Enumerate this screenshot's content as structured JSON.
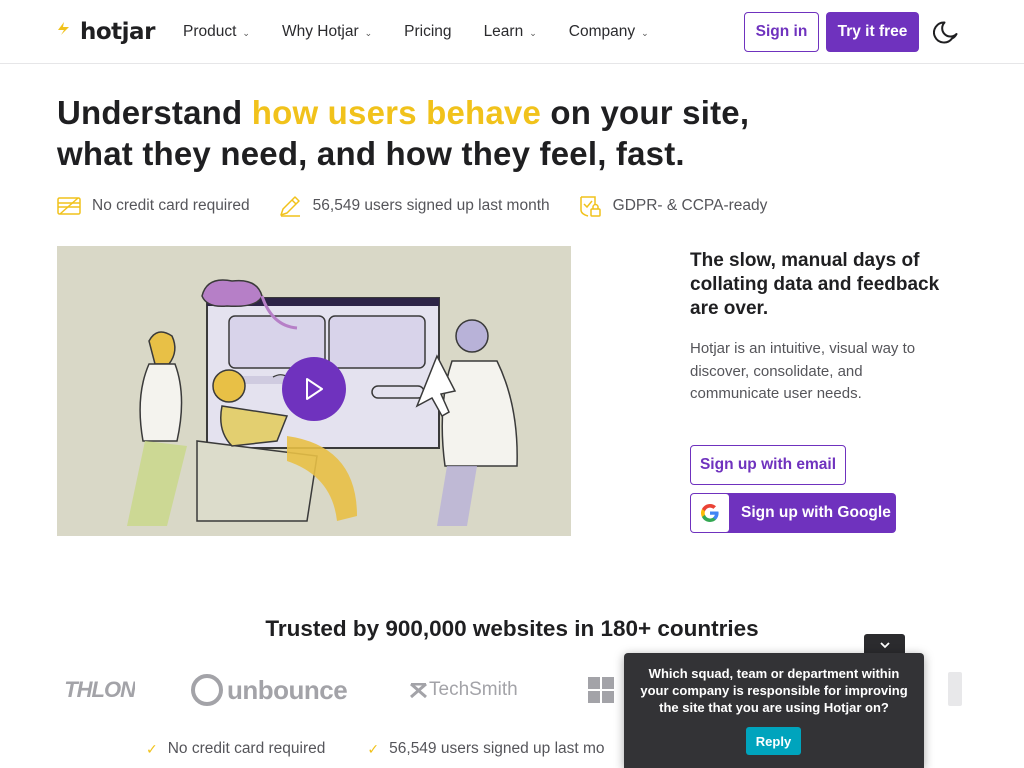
{
  "nav": {
    "logo_text": "hotjar",
    "items": [
      {
        "label": "Product",
        "dropdown": true
      },
      {
        "label": "Why Hotjar",
        "dropdown": true
      },
      {
        "label": "Pricing",
        "dropdown": false
      },
      {
        "label": "Learn",
        "dropdown": true
      },
      {
        "label": "Company",
        "dropdown": true
      }
    ],
    "sign_in": "Sign in",
    "try_free": "Try it free",
    "theme_icon": "moon-icon"
  },
  "hero": {
    "title_before": "Understand ",
    "title_highlight": "how users behave",
    "title_after": " on your site, what they need, and how they feel, fast.",
    "badges": [
      {
        "icon": "credit-card-icon",
        "text": "No credit card required"
      },
      {
        "icon": "pencil-icon",
        "text": "56,549 users signed up last month"
      },
      {
        "icon": "shield-lock-icon",
        "text": "GDPR- & CCPA-ready"
      }
    ]
  },
  "side": {
    "title": "The slow, manual days of collating data and feedback are over.",
    "description": "Hotjar is an intuitive, visual way to discover, consolidate, and communicate user needs.",
    "email_button": "Sign up with email",
    "google_button": "Sign up with Google"
  },
  "trusted": {
    "title": "Trusted by 900,000 websites in 180+ countries",
    "logos": [
      "THLON",
      "unbounce",
      "TechSmith"
    ]
  },
  "bottom_checks": [
    "No credit card required",
    "56,549 users signed up last mo"
  ],
  "survey": {
    "question": "Which squad, team or department within your company is responsible for improving the site that you are using Hotjar on?",
    "reply_button": "Reply",
    "collapse_icon": "chevron-down-icon"
  },
  "colors": {
    "brand_purple": "#6f32be",
    "highlight_yellow": "#f1c21b",
    "survey_bg": "#333336",
    "reply_teal": "#00a4bd"
  }
}
